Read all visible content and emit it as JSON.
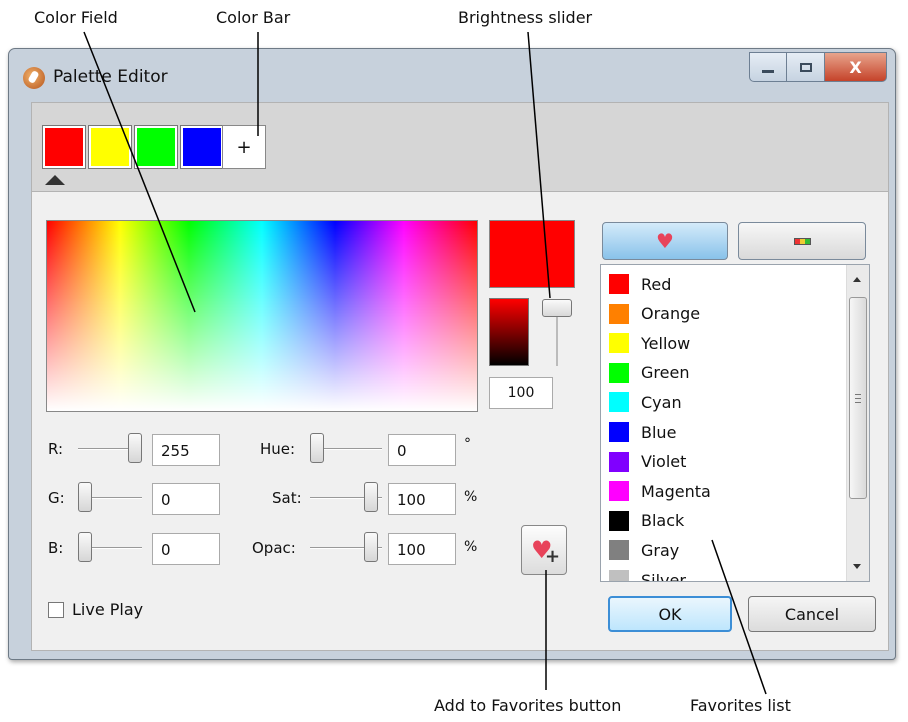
{
  "callouts": {
    "color_field": "Color Field",
    "color_bar": "Color Bar",
    "brightness_slider": "Brightness slider",
    "add_to_favorites": "Add to Favorites button",
    "favorites_list": "Favorites list"
  },
  "window": {
    "title": "Palette Editor",
    "close_glyph": "X"
  },
  "color_bar": {
    "swatches": [
      "#ff0000",
      "#ffff00",
      "#00ff00",
      "#0000ff"
    ],
    "add_label": "+",
    "selected_index": 0
  },
  "preview": {
    "color": "#ff0000",
    "brightness_value": "100"
  },
  "rgb": {
    "r_label": "R:",
    "r_value": "255",
    "r_level": 1.0,
    "g_label": "G:",
    "g_value": "0",
    "g_level": 0.0,
    "b_label": "B:",
    "b_value": "0",
    "b_level": 0.0
  },
  "hsv": {
    "hue_label": "Hue:",
    "hue_value": "0",
    "hue_unit": "°",
    "sat_label": "Sat:",
    "sat_value": "100",
    "sat_unit": "%",
    "opac_label": "Opac:",
    "opac_value": "100",
    "opac_unit": "%"
  },
  "live_play": {
    "label": "Live Play",
    "checked": false
  },
  "favorites": {
    "tab_icons": [
      "heart-icon",
      "palette-icon"
    ],
    "items": [
      {
        "name": "Red",
        "color": "#ff0000"
      },
      {
        "name": "Orange",
        "color": "#ff8000"
      },
      {
        "name": "Yellow",
        "color": "#ffff00"
      },
      {
        "name": "Green",
        "color": "#00ff00"
      },
      {
        "name": "Cyan",
        "color": "#00ffff"
      },
      {
        "name": "Blue",
        "color": "#0000ff"
      },
      {
        "name": "Violet",
        "color": "#8000ff"
      },
      {
        "name": "Magenta",
        "color": "#ff00ff"
      },
      {
        "name": "Black",
        "color": "#000000"
      },
      {
        "name": "Gray",
        "color": "#808080"
      },
      {
        "name": "Silver",
        "color": "#c0c0c0"
      }
    ]
  },
  "buttons": {
    "ok": "OK",
    "cancel": "Cancel"
  }
}
